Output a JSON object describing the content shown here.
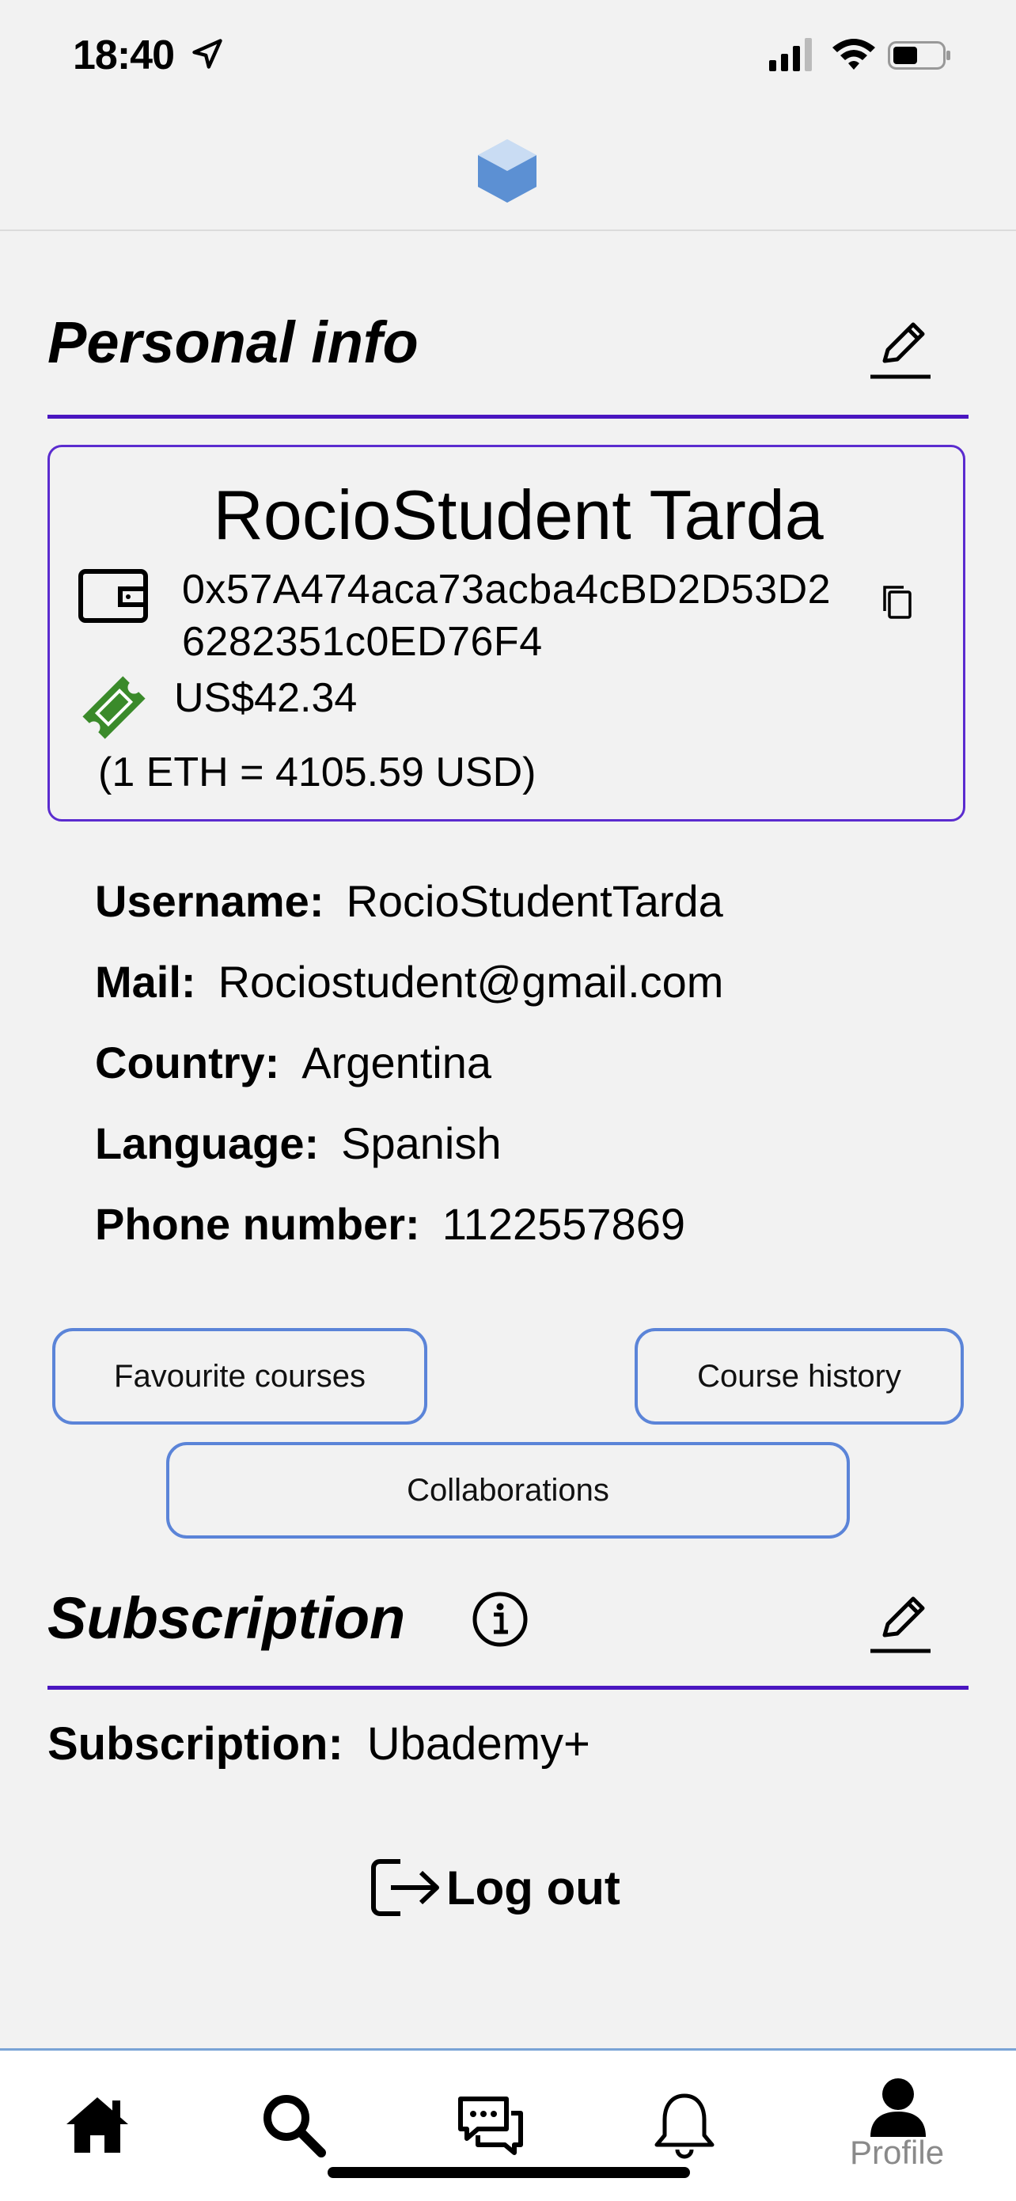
{
  "status_bar": {
    "time": "18:40"
  },
  "personal_info": {
    "title": "Personal info",
    "full_name": "RocioStudent Tarda",
    "wallet_address": "0x57A474aca73acba4cBD2D53D26282351c0ED76F4",
    "balance": "US$42.34",
    "exchange_rate": "(1 ETH = 4105.59 USD)",
    "fields": [
      {
        "label": "Username:",
        "value": "RocioStudentTarda"
      },
      {
        "label": "Mail:",
        "value": "Rociostudent@gmail.com"
      },
      {
        "label": "Country:",
        "value": "Argentina"
      },
      {
        "label": "Language:",
        "value": "Spanish"
      },
      {
        "label": "Phone number:",
        "value": "1122557869"
      }
    ]
  },
  "buttons": {
    "favourite_courses": "Favourite courses",
    "course_history": "Course history",
    "collaborations": "Collaborations"
  },
  "subscription": {
    "title": "Subscription",
    "label": "Subscription:",
    "value": "Ubademy+"
  },
  "logout_label": "Log out",
  "tabbar": {
    "active_label": "Profile",
    "icons": [
      "home-icon",
      "search-icon",
      "chat-icon",
      "bell-icon",
      "profile-icon"
    ]
  },
  "colors": {
    "accent_purple": "#4a16c0",
    "button_border": "#5b84d8",
    "ticket_green": "#3a8a2a"
  }
}
